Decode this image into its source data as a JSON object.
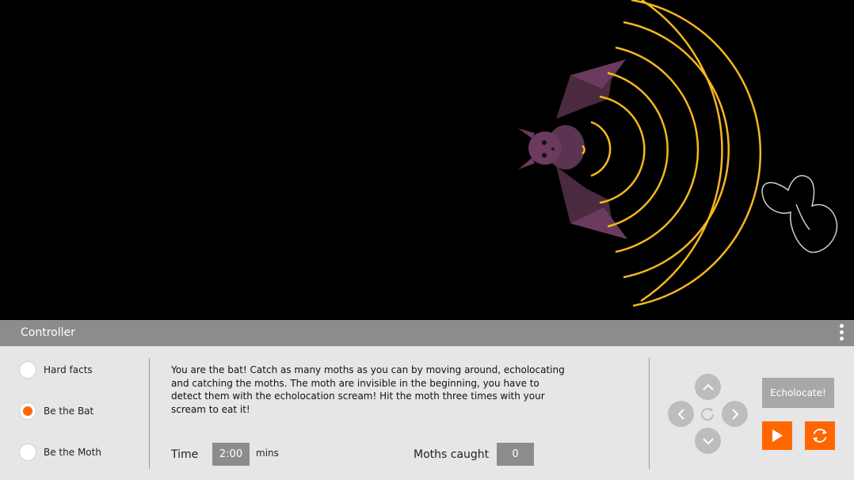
{
  "colors": {
    "wave": "#f5b71e",
    "accent": "#ff6600",
    "bat_wing": "#4a2a3f",
    "bat_body": "#6b3a5e",
    "moth_outline": "#cfcfcf"
  },
  "controller": {
    "title": "Controller",
    "menu_icon": "more-vertical-icon"
  },
  "modes": [
    {
      "label": "Hard facts",
      "selected": false
    },
    {
      "label": "Be the Bat",
      "selected": true
    },
    {
      "label": "Be the Moth",
      "selected": false
    }
  ],
  "description": "You are the bat! Catch as many moths as you can by moving around, echolocating and catching the moths. The moth are invisible in the beginning, you have to detect them with the echolocation scream! Hit the moth three times with your scream to eat it!",
  "time": {
    "label": "Time",
    "value": "2:00",
    "unit": "mins"
  },
  "moths_caught": {
    "label": "Moths caught",
    "value": "0"
  },
  "controls": {
    "up_icon": "chevron-up-icon",
    "down_icon": "chevron-down-icon",
    "left_icon": "chevron-left-icon",
    "right_icon": "chevron-right-icon",
    "rotate_icon": "rotate-icon",
    "echolocate_label": "Echolocate!",
    "play_icon": "play-icon",
    "reset_icon": "refresh-icon"
  }
}
